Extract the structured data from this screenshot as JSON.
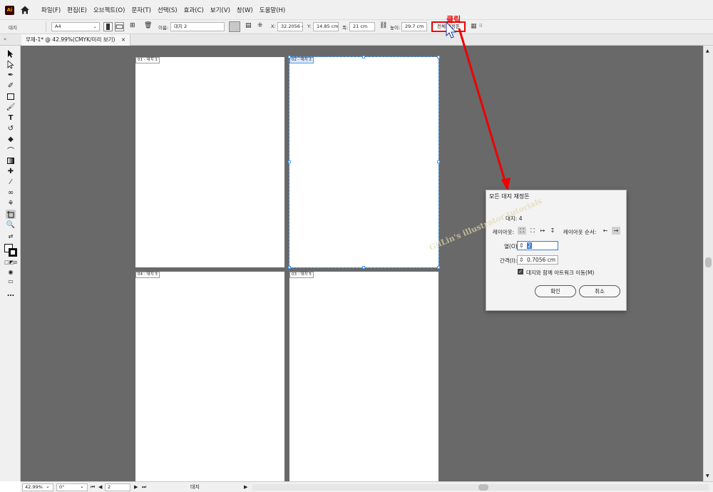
{
  "app": {
    "logo_text": "Ai",
    "accent_color": "#ff9a00"
  },
  "menubar": {
    "items": [
      "파일(F)",
      "편집(E)",
      "오브젝트(O)",
      "문자(T)",
      "선택(S)",
      "효과(C)",
      "보기(V)",
      "창(W)",
      "도움말(H)"
    ]
  },
  "controlbar": {
    "mode_label": "대지",
    "preset": "A4",
    "name_label": "이름:",
    "name_value": "대지 2",
    "x_label": "X:",
    "x_value": "32.2056 cm",
    "y_label": "Y:",
    "y_value": "14.85 cm",
    "w_label": "폭:",
    "w_value": "21 cm",
    "h_label": "높이:",
    "h_value": "29.7 cm",
    "rearrange_label": "전체 재정돈"
  },
  "annotation": {
    "click_text": "클릭",
    "color": "#e00000"
  },
  "document_tab": {
    "title": "무제-1* @ 42.99%(CMYK/미리 보기)",
    "close": "×"
  },
  "artboards": [
    {
      "label": "01 - 대지 1"
    },
    {
      "label": "02 - 대지 2"
    },
    {
      "label": "04 - 대지 3"
    },
    {
      "label": "03 - 대지 5"
    }
  ],
  "dialog": {
    "title": "모든 대지 재정돈",
    "count_label": "대지: 4",
    "layout_label": "레이아웃:",
    "order_label": "레이아웃 순서:",
    "columns_label": "열(O):",
    "columns_value": "2",
    "spacing_label": "간격(I):",
    "spacing_value": "0.7056 cm",
    "move_artwork_label": "대지와 함께 아트워크 이동(M)",
    "move_artwork_checked": true,
    "ok_label": "확인",
    "cancel_label": "취소"
  },
  "watermark_text": "GiiLin's illustrator tutorials",
  "statusbar": {
    "zoom": "42.99%",
    "rotation": "0°",
    "page": "2",
    "tool_name": "대지"
  }
}
